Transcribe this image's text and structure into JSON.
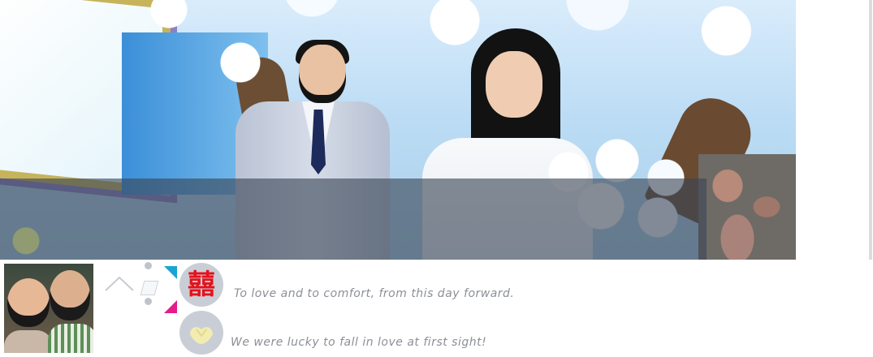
{
  "banner": {
    "photo": "wedding-couple-under-cherry-blossoms"
  },
  "profile": {
    "photo": "couple-avatar"
  },
  "nav": {
    "up_icon": "chevron-up-icon"
  },
  "icons": {
    "xi": "double-happiness-icon",
    "xi_text": "囍",
    "hands": "holding-hands-icon"
  },
  "colors": {
    "accent_cyan": "#1aa4d3",
    "accent_magenta": "#e61b8c",
    "xi_red": "#e5121c",
    "text_gray": "#8b8f96",
    "icon_bg": "#c9ced6"
  },
  "messages": [
    {
      "text": "To love and to comfort, from this day forward."
    },
    {
      "text": "We were lucky to fall in love at first sight!"
    }
  ]
}
